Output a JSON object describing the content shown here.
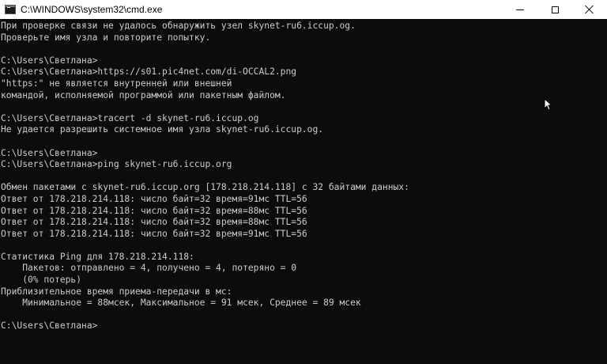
{
  "window": {
    "title": "C:\\WINDOWS\\system32\\cmd.exe"
  },
  "console": {
    "lines": [
      "При проверке связи не удалось обнаружить узел skynet-ru6.iccup.og.",
      "Проверьте имя узла и повторите попытку.",
      "",
      "C:\\Users\\Светлана>",
      "C:\\Users\\Светлана>https://s01.pic4net.com/di-OCCAL2.png",
      "\"https:\" не является внутренней или внешней",
      "командой, исполняемой программой или пакетным файлом.",
      "",
      "C:\\Users\\Светлана>tracert -d skynet-ru6.iccup.og",
      "Не удается разрешить системное имя узла skynet-ru6.iccup.og.",
      "",
      "C:\\Users\\Светлана>",
      "C:\\Users\\Светлана>ping skynet-ru6.iccup.org",
      "",
      "Обмен пакетами с skynet-ru6.iccup.org [178.218.214.118] с 32 байтами данных:",
      "Ответ от 178.218.214.118: число байт=32 время=91мс TTL=56",
      "Ответ от 178.218.214.118: число байт=32 время=88мс TTL=56",
      "Ответ от 178.218.214.118: число байт=32 время=88мс TTL=56",
      "Ответ от 178.218.214.118: число байт=32 время=91мс TTL=56",
      "",
      "Статистика Ping для 178.218.214.118:",
      "    Пакетов: отправлено = 4, получено = 4, потеряно = 0",
      "    (0% потерь)",
      "Приблизительное время приема-передачи в мс:",
      "    Минимальное = 88мсек, Максимальное = 91 мсек, Среднее = 89 мсек",
      "",
      "C:\\Users\\Светлана>"
    ]
  },
  "colors": {
    "console_bg": "#0c0c0c",
    "console_text": "#cccccc",
    "titlebar_bg": "#ffffff"
  }
}
